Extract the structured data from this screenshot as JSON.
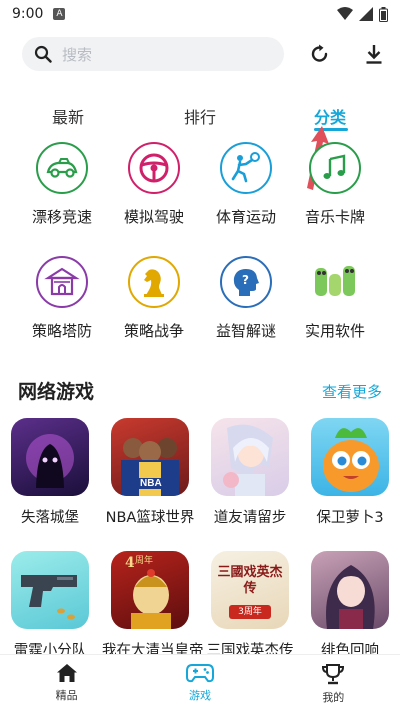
{
  "status": {
    "time": "9:00",
    "indicator": "A"
  },
  "search": {
    "placeholder": "搜索"
  },
  "tabs": [
    {
      "label": "最新",
      "active": false
    },
    {
      "label": "排行",
      "active": false
    },
    {
      "label": "分类",
      "active": true
    }
  ],
  "categories": [
    {
      "label": "漂移竞速",
      "icon": "race-car-icon",
      "color": "#2a9d4a"
    },
    {
      "label": "模拟驾驶",
      "icon": "steering-wheel-icon",
      "color": "#d0206a"
    },
    {
      "label": "体育运动",
      "icon": "sports-icon",
      "color": "#1a9ed8"
    },
    {
      "label": "音乐卡牌",
      "icon": "music-note-icon",
      "color": "#2a9d4a"
    },
    {
      "label": "策略塔防",
      "icon": "fortress-icon",
      "color": "#8a3ba8"
    },
    {
      "label": "策略战争",
      "icon": "chess-knight-icon",
      "color": "#e0a800"
    },
    {
      "label": "益智解谜",
      "icon": "puzzle-head-icon",
      "color": "#2a6db8"
    },
    {
      "label": "实用软件",
      "icon": "app-mascot-icon",
      "color": "#58b84a"
    }
  ],
  "section": {
    "title": "网络游戏",
    "more": "查看更多"
  },
  "games": [
    {
      "name": "失落城堡",
      "icon": "lost-castle-icon"
    },
    {
      "name": "NBA篮球世界",
      "icon": "nba-icon",
      "badge": "NBA"
    },
    {
      "name": "道友请留步",
      "icon": "daoyou-icon"
    },
    {
      "name": "保卫萝卜3",
      "icon": "carrot-icon"
    },
    {
      "name": "雷霆小分队",
      "icon": "pistol-icon"
    },
    {
      "name": "我在大清当皇帝",
      "icon": "qing-emperor-icon",
      "badge": "周年"
    },
    {
      "name": "三国戏英杰传",
      "icon": "sanguo-icon",
      "badge": "三國戏英杰传",
      "badge2": "3周年"
    },
    {
      "name": "绯色回响",
      "icon": "echo-icon"
    }
  ],
  "nav": [
    {
      "label": "精品",
      "icon": "home-icon",
      "active": false
    },
    {
      "label": "游戏",
      "icon": "gamepad-icon",
      "active": true
    },
    {
      "label": "我的",
      "icon": "trophy-icon",
      "active": false
    }
  ],
  "colors": {
    "accent": "#16a7d8",
    "annotation": "#e0505a"
  }
}
